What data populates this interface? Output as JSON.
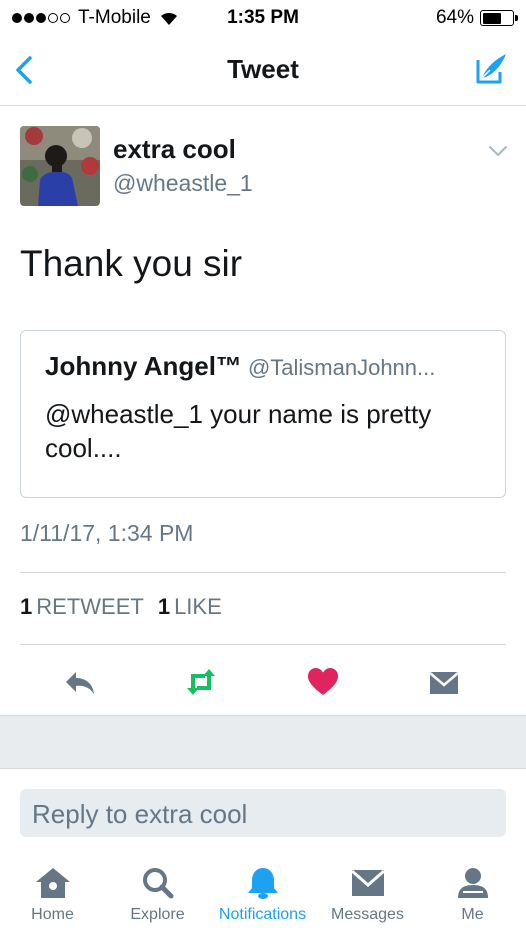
{
  "status_bar": {
    "carrier": "T-Mobile",
    "time": "1:35 PM",
    "battery": "64%",
    "battery_level": 0.64
  },
  "nav": {
    "title": "Tweet",
    "back_icon": "chevron-left-icon",
    "compose_icon": "compose-icon"
  },
  "tweet": {
    "user_name": "extra cool",
    "user_handle": "@wheastle_1",
    "text": "Thank you sir",
    "quoted": {
      "name": "Johnny Angel™",
      "handle": "@TalismanJohnn...",
      "text": "@wheastle_1 your name is pretty cool...."
    },
    "timestamp": "1/11/17, 1:34 PM",
    "stats": {
      "retweets_count": "1",
      "retweets_label": "RETWEET",
      "likes_count": "1",
      "likes_label": "LIKE"
    }
  },
  "reply": {
    "placeholder": "Reply to extra cool"
  },
  "tabs": [
    {
      "label": "Home",
      "icon": "home-icon"
    },
    {
      "label": "Explore",
      "icon": "search-icon"
    },
    {
      "label": "Notifications",
      "icon": "bell-icon"
    },
    {
      "label": "Messages",
      "icon": "envelope-icon"
    },
    {
      "label": "Me",
      "icon": "person-icon"
    }
  ],
  "active_tab": "Notifications",
  "colors": {
    "accent": "#1da1f2",
    "retweet_green": "#17bf63",
    "like_red": "#e0245e",
    "muted": "#657786"
  }
}
